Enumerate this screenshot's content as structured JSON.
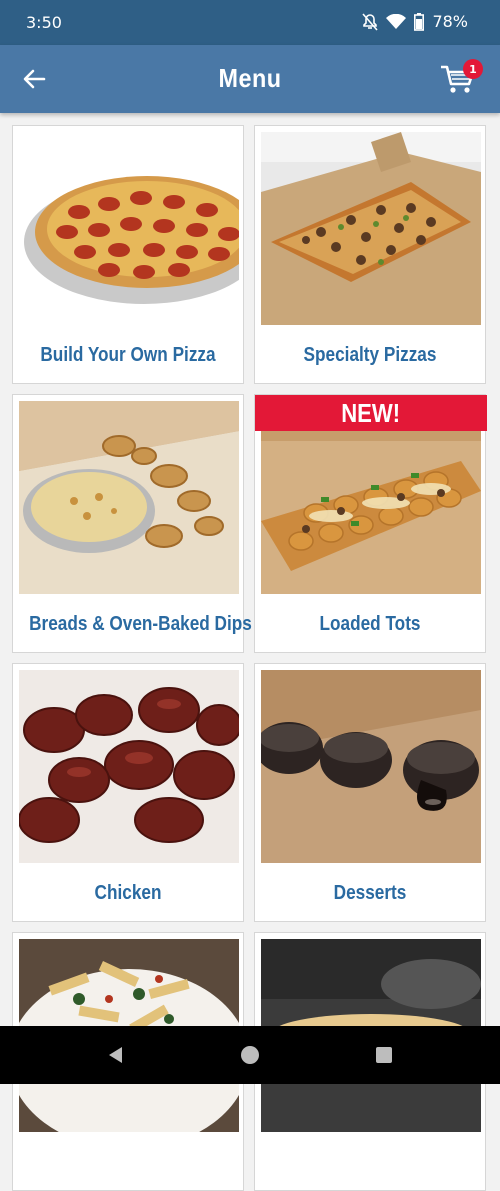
{
  "status_bar": {
    "time": "3:50",
    "battery": "78%"
  },
  "app_bar": {
    "title": "Menu",
    "cart_count": "1"
  },
  "menu": {
    "items": [
      {
        "label": "Build Your Own Pizza",
        "image": "pepperoni-pizza-image",
        "badge": ""
      },
      {
        "label": "Specialty Pizzas",
        "image": "specialty-pizza-image",
        "badge": ""
      },
      {
        "label": "Breads & Oven-Baked Dips",
        "image": "breads-dips-image",
        "badge": ""
      },
      {
        "label": "Loaded Tots",
        "image": "loaded-tots-image",
        "badge": "NEW!"
      },
      {
        "label": "Chicken",
        "image": "chicken-wings-image",
        "badge": ""
      },
      {
        "label": "Desserts",
        "image": "lava-cakes-image",
        "badge": ""
      },
      {
        "label": "",
        "image": "pasta-image",
        "badge": ""
      },
      {
        "label": "",
        "image": "sandwich-image",
        "badge": ""
      }
    ]
  },
  "colors": {
    "app_bar": "#4a78a6",
    "status_bar": "#2f5f86",
    "label": "#2a6aa1",
    "badge": "#e31837"
  }
}
